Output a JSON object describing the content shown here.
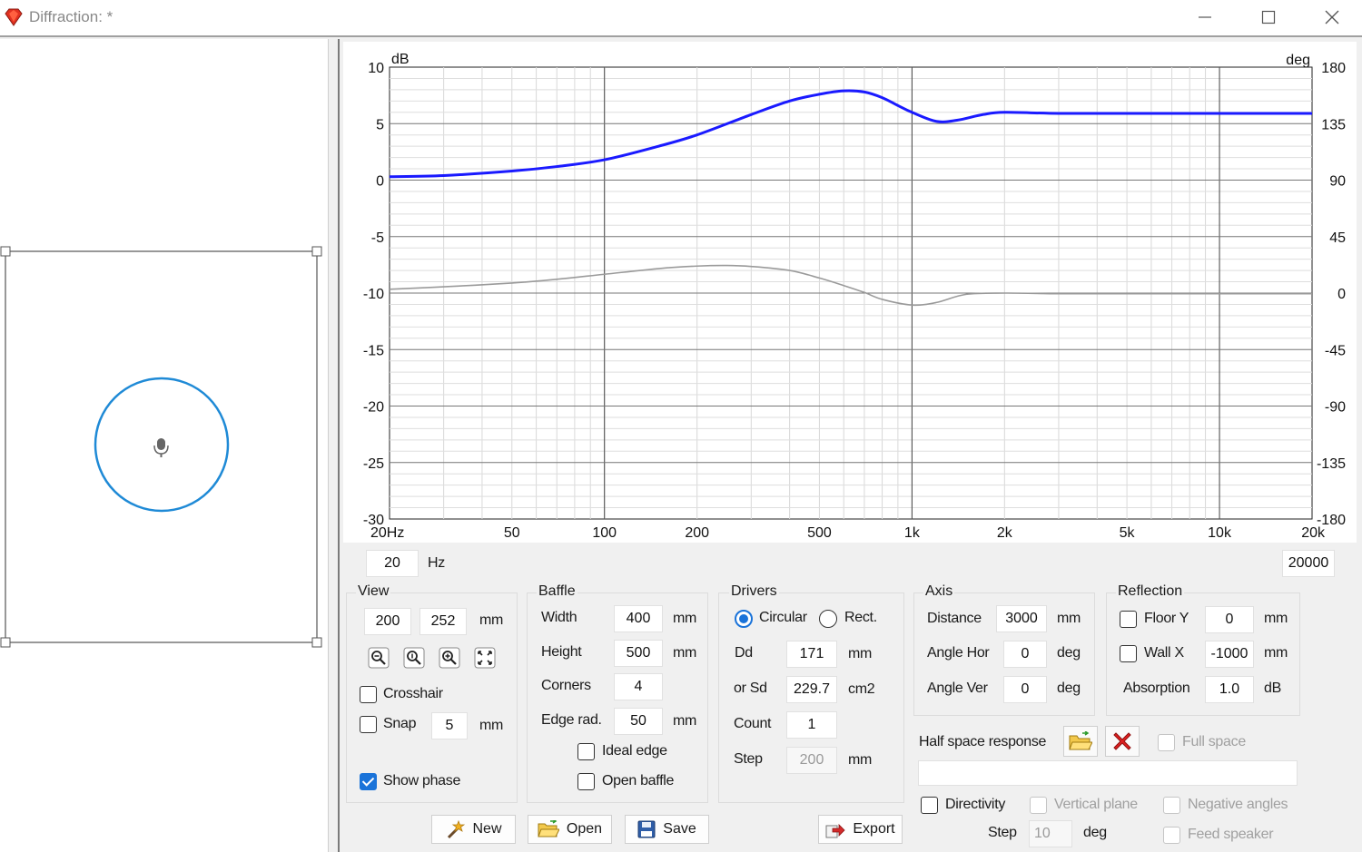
{
  "window": {
    "title": "Diffraction: *"
  },
  "chart_data": {
    "type": "line",
    "x_scale": "log",
    "xlim": [
      20,
      20000
    ],
    "x_ticks": [
      20,
      50,
      100,
      200,
      500,
      1000,
      2000,
      5000,
      10000,
      20000
    ],
    "x_tick_labels": [
      "20Hz",
      "50",
      "100",
      "200",
      "500",
      "1k",
      "2k",
      "5k",
      "10k",
      "20k"
    ],
    "ylim": [
      -30,
      10
    ],
    "y_ticks": [
      10,
      5,
      0,
      -5,
      -10,
      -15,
      -20,
      -25,
      -30
    ],
    "ylabel": "dB",
    "y2lim": [
      -180,
      180
    ],
    "y2_ticks": [
      180,
      135,
      90,
      45,
      0,
      -45,
      -90,
      -135,
      -180
    ],
    "y2label": "deg",
    "grid": true,
    "series": [
      {
        "axis": "left",
        "color": "#1a1aff",
        "x": [
          20,
          30,
          50,
          70,
          100,
          150,
          200,
          300,
          400,
          500,
          600,
          700,
          800,
          900,
          1000,
          1200,
          1400,
          1700,
          2000,
          3000,
          5000,
          10000,
          20000
        ],
        "y": [
          0.3,
          0.4,
          0.8,
          1.2,
          1.8,
          3.0,
          4.0,
          5.8,
          7.0,
          7.6,
          7.9,
          7.8,
          7.3,
          6.6,
          6.0,
          5.2,
          5.3,
          5.8,
          6.0,
          5.9,
          5.9,
          5.9,
          5.9
        ]
      },
      {
        "axis": "right",
        "color": "#9a9a9a",
        "x": [
          20,
          30,
          50,
          70,
          100,
          150,
          200,
          250,
          300,
          400,
          500,
          600,
          700,
          800,
          1000,
          1200,
          1500,
          2000,
          3000,
          5000,
          10000,
          20000
        ],
        "y": [
          3,
          5,
          8,
          11,
          15,
          19.5,
          21.5,
          22,
          21.2,
          18,
          12,
          6,
          0.5,
          -5,
          -9.5,
          -7.5,
          -1,
          0,
          -0.5,
          -0.5,
          -0.5,
          -0.5
        ]
      }
    ]
  },
  "freq": {
    "min": "20",
    "unit": "Hz",
    "max": "20000"
  },
  "view": {
    "title": "View",
    "width": "200",
    "height": "252",
    "unit": "mm",
    "crosshair_label": "Crosshair",
    "snap_label": "Snap",
    "snap_value": "5",
    "snap_unit": "mm",
    "show_phase_label": "Show phase"
  },
  "baffle": {
    "title": "Baffle",
    "width_label": "Width",
    "width_value": "400",
    "width_unit": "mm",
    "height_label": "Height",
    "height_value": "500",
    "height_unit": "mm",
    "corners_label": "Corners",
    "corners_value": "4",
    "edge_label": "Edge rad.",
    "edge_value": "50",
    "edge_unit": "mm",
    "ideal_edge_label": "Ideal edge",
    "open_baffle_label": "Open baffle"
  },
  "drivers": {
    "title": "Drivers",
    "circular_label": "Circular",
    "rect_label": "Rect.",
    "dd_label": "Dd",
    "dd_value": "171",
    "dd_unit": "mm",
    "sd_label": "or Sd",
    "sd_value": "229.7",
    "sd_unit": "cm2",
    "count_label": "Count",
    "count_value": "1",
    "step_label": "Step",
    "step_value": "200",
    "step_unit": "mm"
  },
  "axis": {
    "title": "Axis",
    "distance_label": "Distance",
    "distance_value": "3000",
    "distance_unit": "mm",
    "angle_hor_label": "Angle Hor",
    "angle_hor_value": "0",
    "angle_hor_unit": "deg",
    "angle_ver_label": "Angle Ver",
    "angle_ver_value": "0",
    "angle_ver_unit": "deg"
  },
  "reflection": {
    "title": "Reflection",
    "floor_label": "Floor Y",
    "floor_value": "0",
    "floor_unit": "mm",
    "wall_label": "Wall  X",
    "wall_value": "-1000",
    "wall_unit": "mm",
    "absorption_label": "Absorption",
    "absorption_value": "1.0",
    "absorption_unit": "dB"
  },
  "half_space": {
    "label": "Half space response",
    "full_space_label": "Full space"
  },
  "directivity": {
    "label": "Directivity",
    "vertical_plane_label": "Vertical plane",
    "negative_angles_label": "Negative angles",
    "feed_speaker_label": "Feed speaker",
    "step_label": "Step",
    "step_value": "10",
    "step_unit": "deg"
  },
  "buttons": {
    "new": "New",
    "open": "Open",
    "save": "Save",
    "export": "Export"
  }
}
